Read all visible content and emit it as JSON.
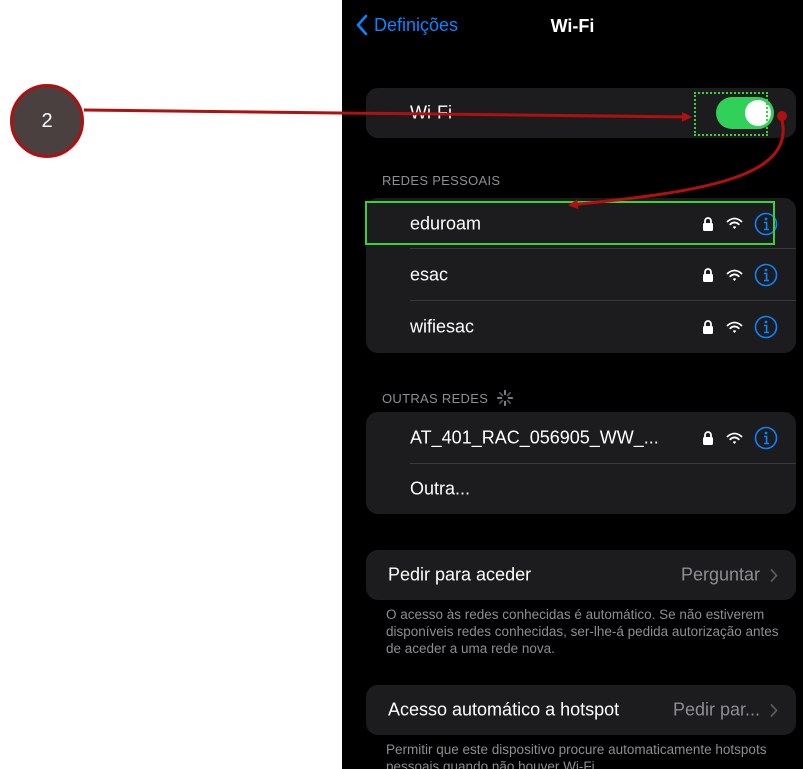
{
  "navbar": {
    "back_label": "Definições",
    "title": "Wi-Fi"
  },
  "wifi_toggle": {
    "label": "Wi-Fi",
    "state": "on"
  },
  "personal": {
    "header": "REDES PESSOAIS",
    "networks": [
      {
        "name": "eduroam",
        "secured": true
      },
      {
        "name": "esac",
        "secured": true
      },
      {
        "name": "wifiesac",
        "secured": true
      }
    ]
  },
  "other": {
    "header": "OUTRAS REDES",
    "networks": [
      {
        "name": "AT_401_RAC_056905_WW_...",
        "secured": true
      }
    ],
    "other_label": "Outra..."
  },
  "ask_join": {
    "label": "Pedir para aceder",
    "value": "Perguntar",
    "footer": "O acesso às redes conhecidas é automático. Se não estiverem disponíveis redes conhecidas, ser-lhe-á pedida autorização antes de aceder a uma rede nova."
  },
  "auto_hotspot": {
    "label": "Acesso automático a hotspot",
    "value": "Pedir par...",
    "footer": "Permitir que este dispositivo procure automaticamente hotspots pessoais quando não houver Wi-Fi."
  },
  "annotation": {
    "step": "2"
  },
  "colors": {
    "accent": "#0a84ff",
    "toggle_on": "#30d158",
    "highlight": "#3ad13a",
    "arrow": "#b01010"
  },
  "icons": [
    "chevron-left-icon",
    "lock-icon",
    "wifi-icon",
    "info-icon",
    "spinner-icon",
    "chevron-right-icon"
  ]
}
